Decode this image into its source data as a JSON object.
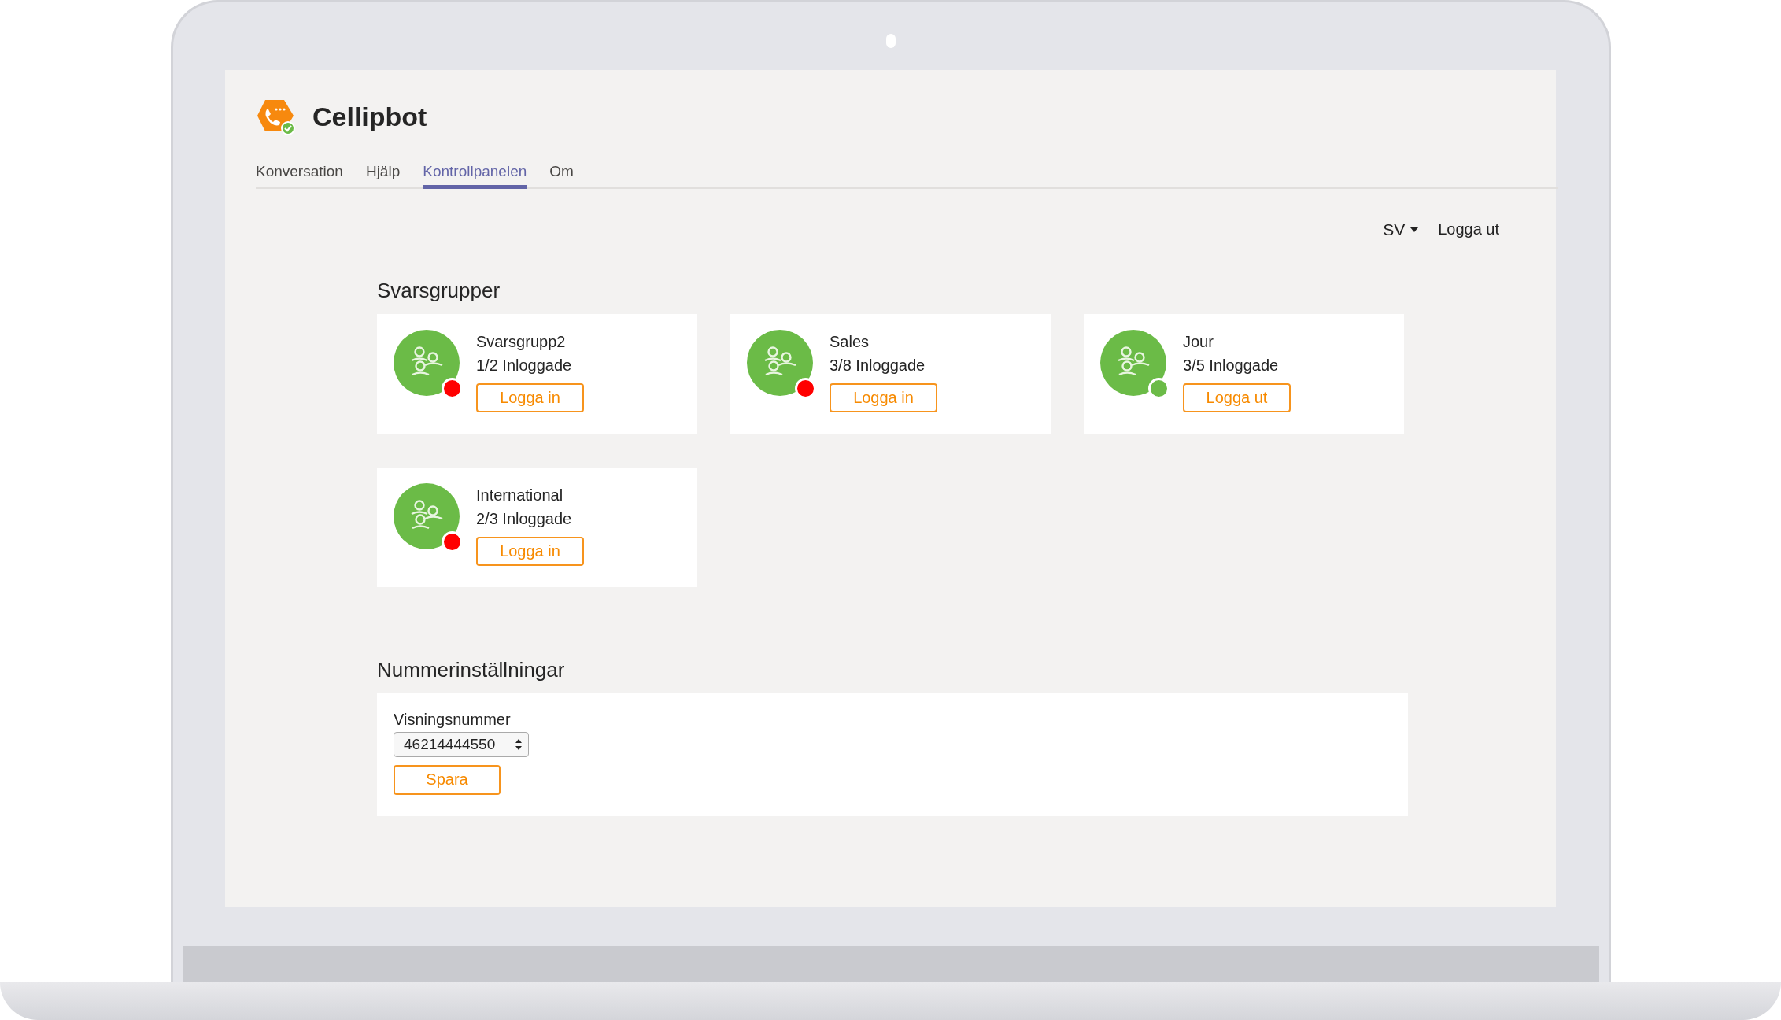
{
  "app": {
    "title": "Cellipbot"
  },
  "tabs": [
    {
      "label": "Konversation",
      "selected": false
    },
    {
      "label": "Hjälp",
      "selected": false
    },
    {
      "label": "Kontrollpanelen",
      "selected": true
    },
    {
      "label": "Om",
      "selected": false
    }
  ],
  "user_bar": {
    "language": "SV",
    "logout": "Logga ut"
  },
  "groups_section": {
    "title": "Svarsgrupper",
    "groups": [
      {
        "name": "Svarsgrupp2",
        "logged_in": "1/2 Inloggade",
        "color": "#ff0000",
        "button": "Logga in"
      },
      {
        "name": "Sales",
        "logged_in": "3/8 Inloggade",
        "color": "#ff0000",
        "button": "Logga in"
      },
      {
        "name": "Jour",
        "logged_in": "3/5 Inloggade",
        "color": "#6bbb47",
        "button": "Logga ut"
      },
      {
        "name": "International",
        "logged_in": "2/3 Inloggade",
        "color": "#ff0000",
        "button": "Logga in"
      }
    ]
  },
  "number_settings": {
    "title": "Nummerinställningar",
    "field_label": "Visningsnummer",
    "value": "46214444550",
    "button": "Spara"
  }
}
